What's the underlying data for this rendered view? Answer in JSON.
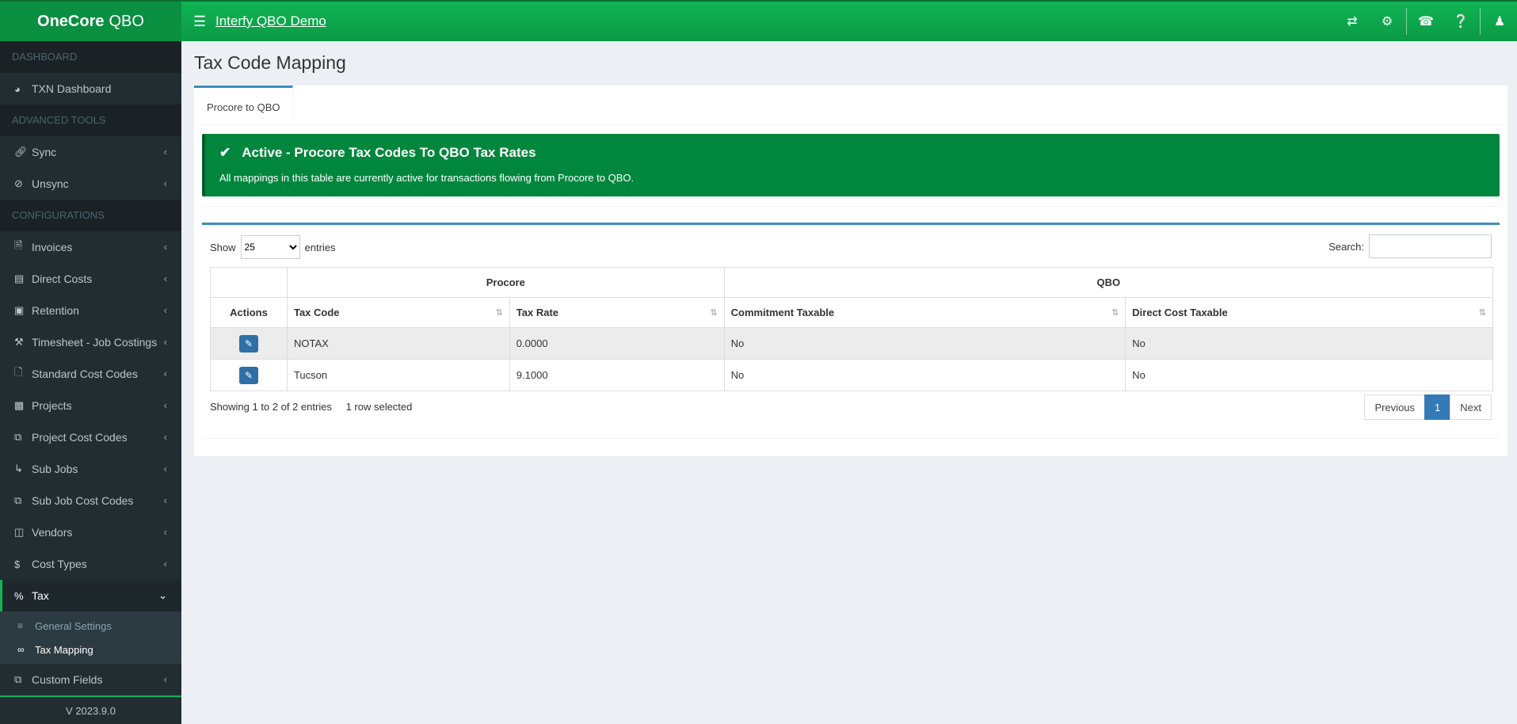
{
  "app": {
    "logo_bold": "OneCore",
    "logo_rest": "QBO",
    "title": "Interfy QBO Demo",
    "version": "V 2023.9.0"
  },
  "topbar_icons": [
    "transfer-icon",
    "gears-icon",
    "headset-icon",
    "help-icon",
    "user-icon"
  ],
  "sidebar": {
    "sections": [
      "DASHBOARD",
      "ADVANCED TOOLS",
      "CONFIGURATIONS"
    ],
    "dashboard": [
      {
        "label": "TXN Dashboard",
        "icon": "dashboard-icon"
      }
    ],
    "advanced": [
      {
        "label": "Sync",
        "icon": "link-icon"
      },
      {
        "label": "Unsync",
        "icon": "unlink-icon"
      }
    ],
    "config": [
      {
        "label": "Invoices",
        "icon": "file-icon"
      },
      {
        "label": "Direct Costs",
        "icon": "credit-card-icon"
      },
      {
        "label": "Retention",
        "icon": "lock-icon"
      },
      {
        "label": "Timesheet - Job Costings",
        "icon": "tools-icon"
      },
      {
        "label": "Standard Cost Codes",
        "icon": "document-icon"
      },
      {
        "label": "Projects",
        "icon": "building-icon"
      },
      {
        "label": "Project Cost Codes",
        "icon": "copy-icon"
      },
      {
        "label": "Sub Jobs",
        "icon": "level-down-icon"
      },
      {
        "label": "Sub Job Cost Codes",
        "icon": "copy-icon"
      },
      {
        "label": "Vendors",
        "icon": "id-card-icon"
      },
      {
        "label": "Cost Types",
        "icon": "dollar-icon"
      }
    ],
    "active": {
      "label": "Tax",
      "icon": "percent-icon"
    },
    "submenu": [
      {
        "label": "General Settings",
        "icon": "sliders-icon"
      },
      {
        "label": "Tax Mapping",
        "icon": "link-icon"
      }
    ],
    "after": [
      {
        "label": "Custom Fields",
        "icon": "copy-icon"
      }
    ]
  },
  "page": {
    "title": "Tax Code Mapping",
    "tab": "Procore to QBO"
  },
  "alert": {
    "title": "Active - Procore Tax Codes To QBO Tax Rates",
    "text": "All mappings in this table are currently active for transactions flowing from Procore to QBO."
  },
  "table": {
    "show_label": "Show",
    "entries_label": "entries",
    "page_size": "25",
    "search_label": "Search:",
    "group_headers": [
      "Procore",
      "QBO"
    ],
    "columns": [
      "Actions",
      "Tax Code",
      "Tax Rate",
      "Commitment Taxable",
      "Direct Cost Taxable"
    ],
    "rows": [
      {
        "tax_code": "NOTAX",
        "tax_rate": "0.0000",
        "commitment": "No",
        "direct": "No"
      },
      {
        "tax_code": "Tucson",
        "tax_rate": "9.1000",
        "commitment": "No",
        "direct": "No"
      }
    ],
    "info": "Showing 1 to 2 of 2 entries",
    "selected": "1 row selected",
    "pager": {
      "prev": "Previous",
      "page": "1",
      "next": "Next"
    }
  }
}
